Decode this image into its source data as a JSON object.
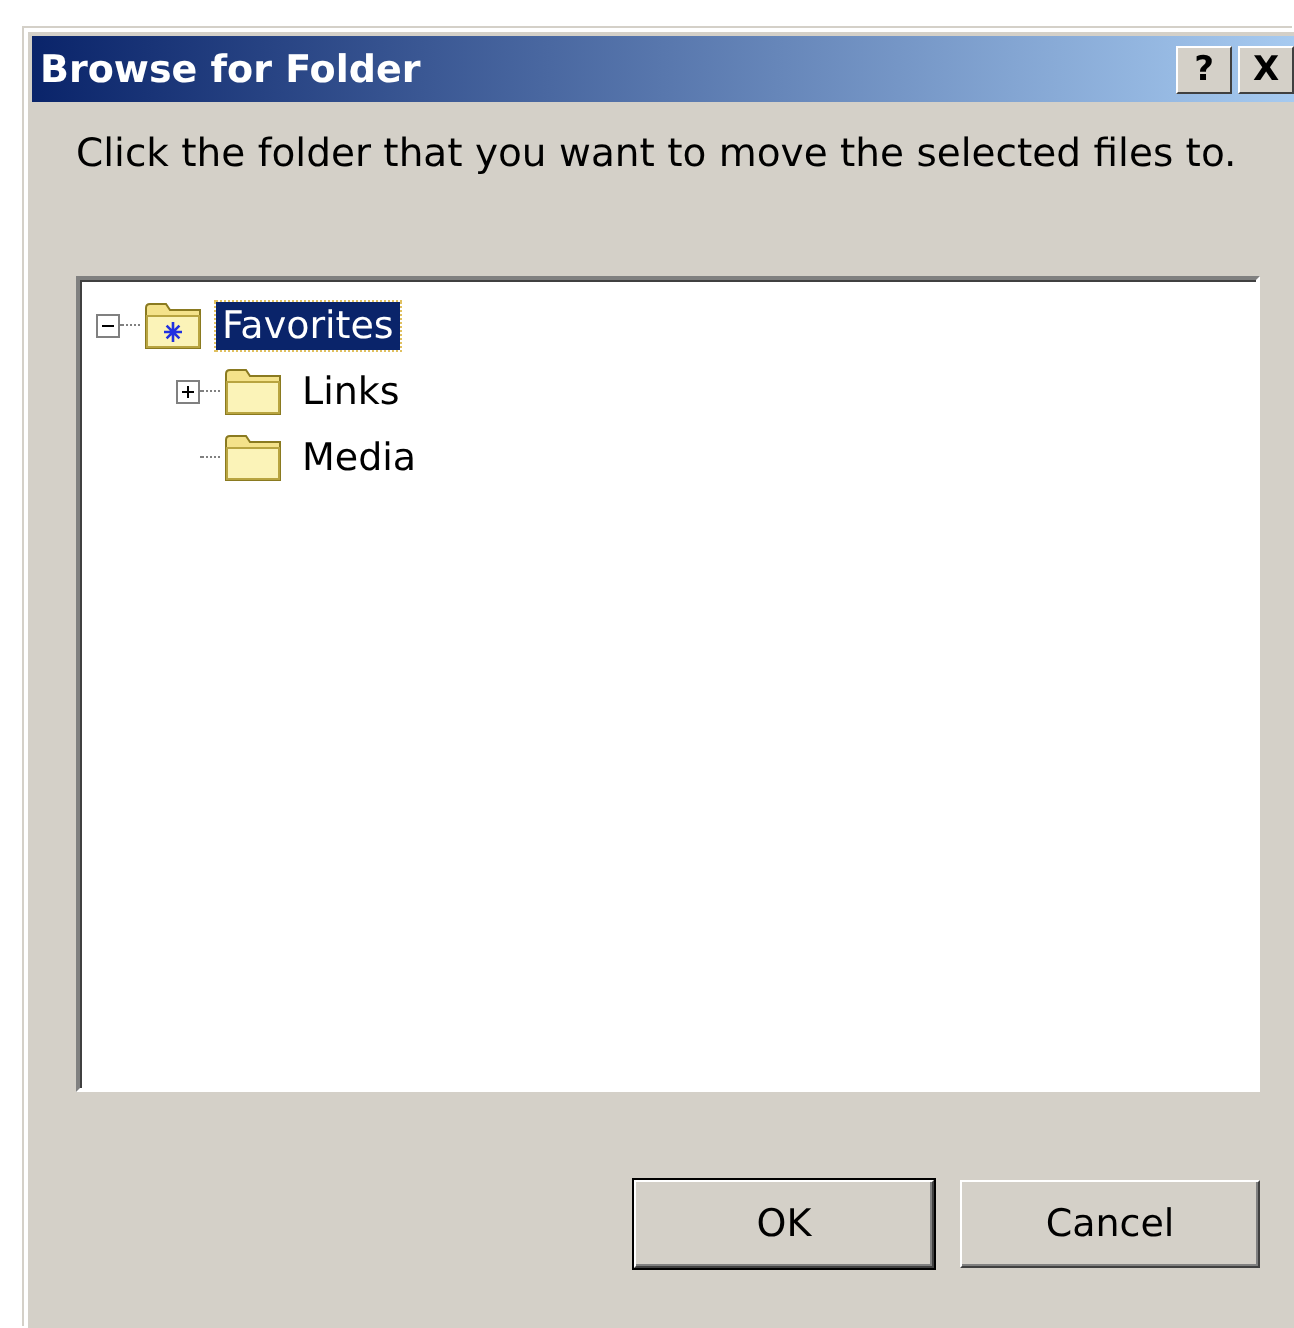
{
  "window": {
    "title": "Browse for Folder",
    "title_buttons": [
      "?",
      "X"
    ]
  },
  "instruction": "Click the folder that you want to move the selected files to.",
  "tree": [
    {
      "label": "Favorites",
      "kind": "favorites",
      "selected": true,
      "expanded": true,
      "children": [
        {
          "label": "Links",
          "selected": false,
          "expanded": false
        },
        {
          "label": "Media",
          "selected": false
        }
      ]
    }
  ],
  "buttons": [
    {
      "label": "OK",
      "default": true
    },
    {
      "label": "Cancel",
      "default": false
    }
  ]
}
